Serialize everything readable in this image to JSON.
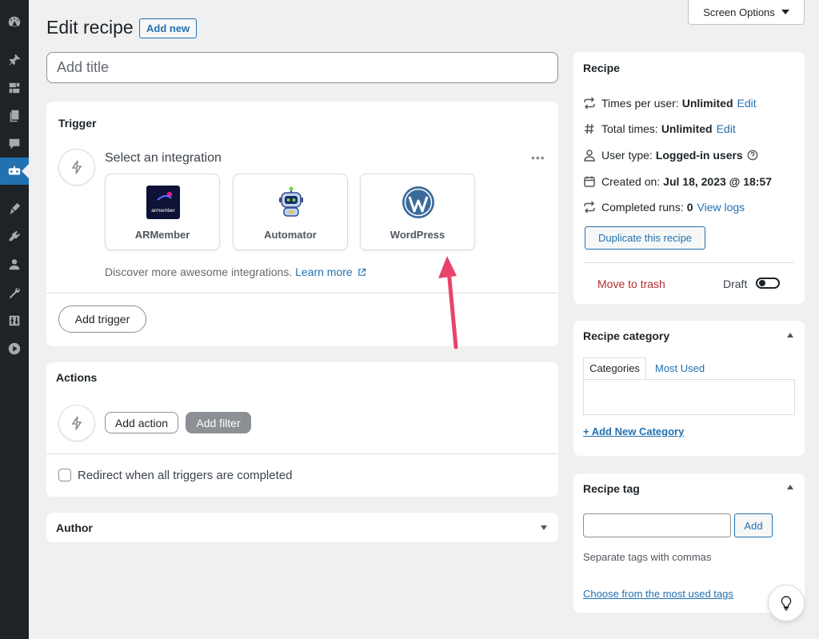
{
  "header": {
    "title": "Edit recipe",
    "add_new": "Add new",
    "screen_options": "Screen Options"
  },
  "title_field": {
    "placeholder": "Add title",
    "value": ""
  },
  "trigger": {
    "heading": "Trigger",
    "select_label": "Select an integration",
    "integrations": [
      {
        "name": "ARMember",
        "icon": "armember-logo"
      },
      {
        "name": "Automator",
        "icon": "automator-robot-logo"
      },
      {
        "name": "WordPress",
        "icon": "wordpress-logo"
      }
    ],
    "discover_text": "Discover more awesome integrations.",
    "learn_more": "Learn more",
    "add_trigger": "Add trigger"
  },
  "actions": {
    "heading": "Actions",
    "add_action": "Add action",
    "add_filter": "Add filter",
    "redirect_label": "Redirect when all triggers are completed",
    "redirect_checked": false
  },
  "author": {
    "heading": "Author"
  },
  "recipe_box": {
    "heading": "Recipe",
    "times_per_user_label": "Times per user:",
    "times_per_user_value": "Unlimited",
    "total_times_label": "Total times:",
    "total_times_value": "Unlimited",
    "edit": "Edit",
    "user_type_label": "User type:",
    "user_type_value": "Logged-in users",
    "created_on_label": "Created on:",
    "created_on_value": "Jul 18, 2023 @ 18:57",
    "completed_runs_label": "Completed runs:",
    "completed_runs_value": "0",
    "view_logs": "View logs",
    "duplicate": "Duplicate this recipe",
    "move_to_trash": "Move to trash",
    "status_label": "Draft",
    "status_live": false
  },
  "category_box": {
    "heading": "Recipe category",
    "tab_categories": "Categories",
    "tab_most_used": "Most Used",
    "add_new_category": "+ Add New Category"
  },
  "tag_box": {
    "heading": "Recipe tag",
    "add_button": "Add",
    "tag_value": "",
    "help": "Separate tags with commas",
    "choose_link": "Choose from the most used tags"
  },
  "colors": {
    "accent": "#2271b1",
    "trash": "#b32d2e",
    "arrow": "#e8446a",
    "sidebar": "#1d2327"
  }
}
